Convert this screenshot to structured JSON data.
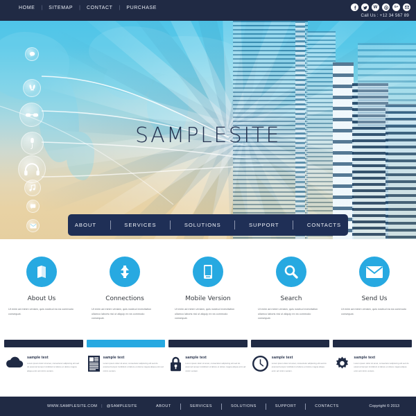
{
  "topbar": {
    "links": [
      "HOME",
      "SITEMAP",
      "CONTACT",
      "PURCHASE"
    ],
    "separator": "|",
    "social_icons": [
      "facebook-icon",
      "twitter-icon",
      "wordpress-icon",
      "skype-icon",
      "google-plus-icon",
      "email-icon"
    ],
    "call_us": "Call Us : +12 34 567 89"
  },
  "hero": {
    "title": "SAMPLESITE",
    "bubble_icons": [
      "speech-bubble-icon",
      "rabbit-ears-icon",
      "sunglasses-icon",
      "microphone-icon",
      "headphones-icon",
      "music-note-icon",
      "chat-icon",
      "envelope-icon"
    ]
  },
  "mainnav": {
    "links": [
      "ABOUT",
      "SERVICES",
      "SOLUTIONS",
      "SUPPORT",
      "CONTACTS"
    ]
  },
  "features": [
    {
      "icon": "book-icon",
      "title": "About Us",
      "text": "Ut enim ad minim veniam, quis nostrud ea ea commodo consequat."
    },
    {
      "icon": "transfer-arrows-icon",
      "title": "Connections",
      "text": "Ut enim ad minim veniam, quis nostrud exercitation ullamco laboris nisi ut aliquip ex ea commodo consequat."
    },
    {
      "icon": "mobile-phone-icon",
      "title": "Mobile Version",
      "text": "Ut enim ad minim veniam, quis nostrud exercitation ullamco laboris nisi ut aliquip ex ea commodo consequat."
    },
    {
      "icon": "magnifier-icon",
      "title": "Search",
      "text": "Ut enim ad minim veniam, quis nostrud exercitation ullamco laboris nisi ut aliquip ex ea commodo consequat."
    },
    {
      "icon": "envelope-icon",
      "title": "Send Us",
      "text": "Ut enim ad minim veniam, quis nostrud ea ea commodo consequat."
    }
  ],
  "strip": [
    {
      "icon": "cloud-icon",
      "active": false,
      "title": "sample text",
      "text": "Lorem ipsum dolor sit amet, consectetur adipiscing elit sed do eiusmod tempor incididunt ut labore et dolore magna aliqua enim ad minim veniam."
    },
    {
      "icon": "document-icon",
      "active": true,
      "title": "sample text",
      "text": "Lorem ipsum dolor sit amet, consectetur adipiscing elit sed do eiusmod tempor incididunt ut labore et dolore magna aliqua enim ad minim veniam."
    },
    {
      "icon": "lock-icon",
      "active": false,
      "title": "sample text",
      "text": "Lorem ipsum dolor sit amet, consectetur adipiscing elit sed do eiusmod tempor incididunt ut labore et dolore magna aliqua enim ad minim veniam."
    },
    {
      "icon": "clock-icon",
      "active": false,
      "title": "sample text",
      "text": "Lorem ipsum dolor sit amet, consectetur adipiscing elit sed do eiusmod tempor incididunt ut labore et dolore magna aliqua enim ad minim veniam."
    },
    {
      "icon": "gear-icon",
      "active": false,
      "title": "sample text",
      "text": "Lorem ipsum dolor sit amet, consectetur adipiscing elit sed do eiusmod tempor incididunt ut labore et dolore magna aliqua enim ad minim veniam."
    }
  ],
  "footer": {
    "website": "WWW.SAMPLESITE.COM",
    "separator": "|",
    "handle": "@SAMPLESITE",
    "links": [
      "ABOUT",
      "SERVICES",
      "SOLUTIONS",
      "SUPPORT",
      "CONTACTS"
    ],
    "copyright": "Copyright © 2013"
  },
  "colors": {
    "navy": "#202a44",
    "nav_navy": "#1f2f56",
    "accent_blue": "#27a9e1",
    "hero_sky": "#4fc4e8",
    "hero_sand": "#e6cfa0"
  }
}
